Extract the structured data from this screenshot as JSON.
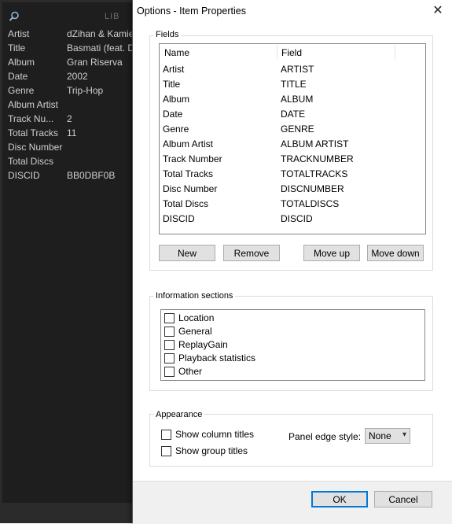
{
  "background_app": {
    "panel_label": "LIB",
    "properties": [
      {
        "name": "Artist",
        "value": "dZihan & Kamien"
      },
      {
        "name": "Title",
        "value": "Basmati (feat. D"
      },
      {
        "name": "Album",
        "value": "Gran Riserva"
      },
      {
        "name": "Date",
        "value": "2002"
      },
      {
        "name": "Genre",
        "value": "Trip-Hop"
      },
      {
        "name": "Album Artist",
        "value": ""
      },
      {
        "name": "Track Nu...",
        "value": "2"
      },
      {
        "name": "Total Tracks",
        "value": "11"
      },
      {
        "name": "Disc Number",
        "value": ""
      },
      {
        "name": "Total Discs",
        "value": ""
      },
      {
        "name": "DISCID",
        "value": "BB0DBF0B"
      }
    ]
  },
  "dialog": {
    "title": "Options - Item Properties",
    "close_icon": "close-icon",
    "fields": {
      "group_label": "Fields",
      "columns": [
        "Name",
        "Field"
      ],
      "rows": [
        {
          "name": "Artist",
          "field": "ARTIST"
        },
        {
          "name": "Title",
          "field": "TITLE"
        },
        {
          "name": "Album",
          "field": "ALBUM"
        },
        {
          "name": "Date",
          "field": "DATE"
        },
        {
          "name": "Genre",
          "field": "GENRE"
        },
        {
          "name": "Album Artist",
          "field": "ALBUM ARTIST"
        },
        {
          "name": "Track Number",
          "field": "TRACKNUMBER"
        },
        {
          "name": "Total Tracks",
          "field": "TOTALTRACKS"
        },
        {
          "name": "Disc Number",
          "field": "DISCNUMBER"
        },
        {
          "name": "Total Discs",
          "field": "TOTALDISCS"
        },
        {
          "name": "DISCID",
          "field": "DISCID"
        }
      ],
      "buttons": {
        "new": "New",
        "remove": "Remove",
        "move_up": "Move up",
        "move_down": "Move down"
      }
    },
    "info_sections": {
      "group_label": "Information sections",
      "items": [
        {
          "label": "Location",
          "checked": false
        },
        {
          "label": "General",
          "checked": false
        },
        {
          "label": "ReplayGain",
          "checked": false
        },
        {
          "label": "Playback statistics",
          "checked": false
        },
        {
          "label": "Other",
          "checked": false
        }
      ]
    },
    "appearance": {
      "group_label": "Appearance",
      "show_column_titles": {
        "label": "Show column titles",
        "checked": false
      },
      "show_group_titles": {
        "label": "Show group titles",
        "checked": false
      },
      "panel_edge_label": "Panel edge style:",
      "panel_edge_value": "None"
    },
    "footer": {
      "ok": "OK",
      "cancel": "Cancel"
    }
  },
  "colors": {
    "accent": "#0078d7",
    "dark_bg": "#1e1e1e",
    "dialog_bg": "#f0f0f0"
  }
}
